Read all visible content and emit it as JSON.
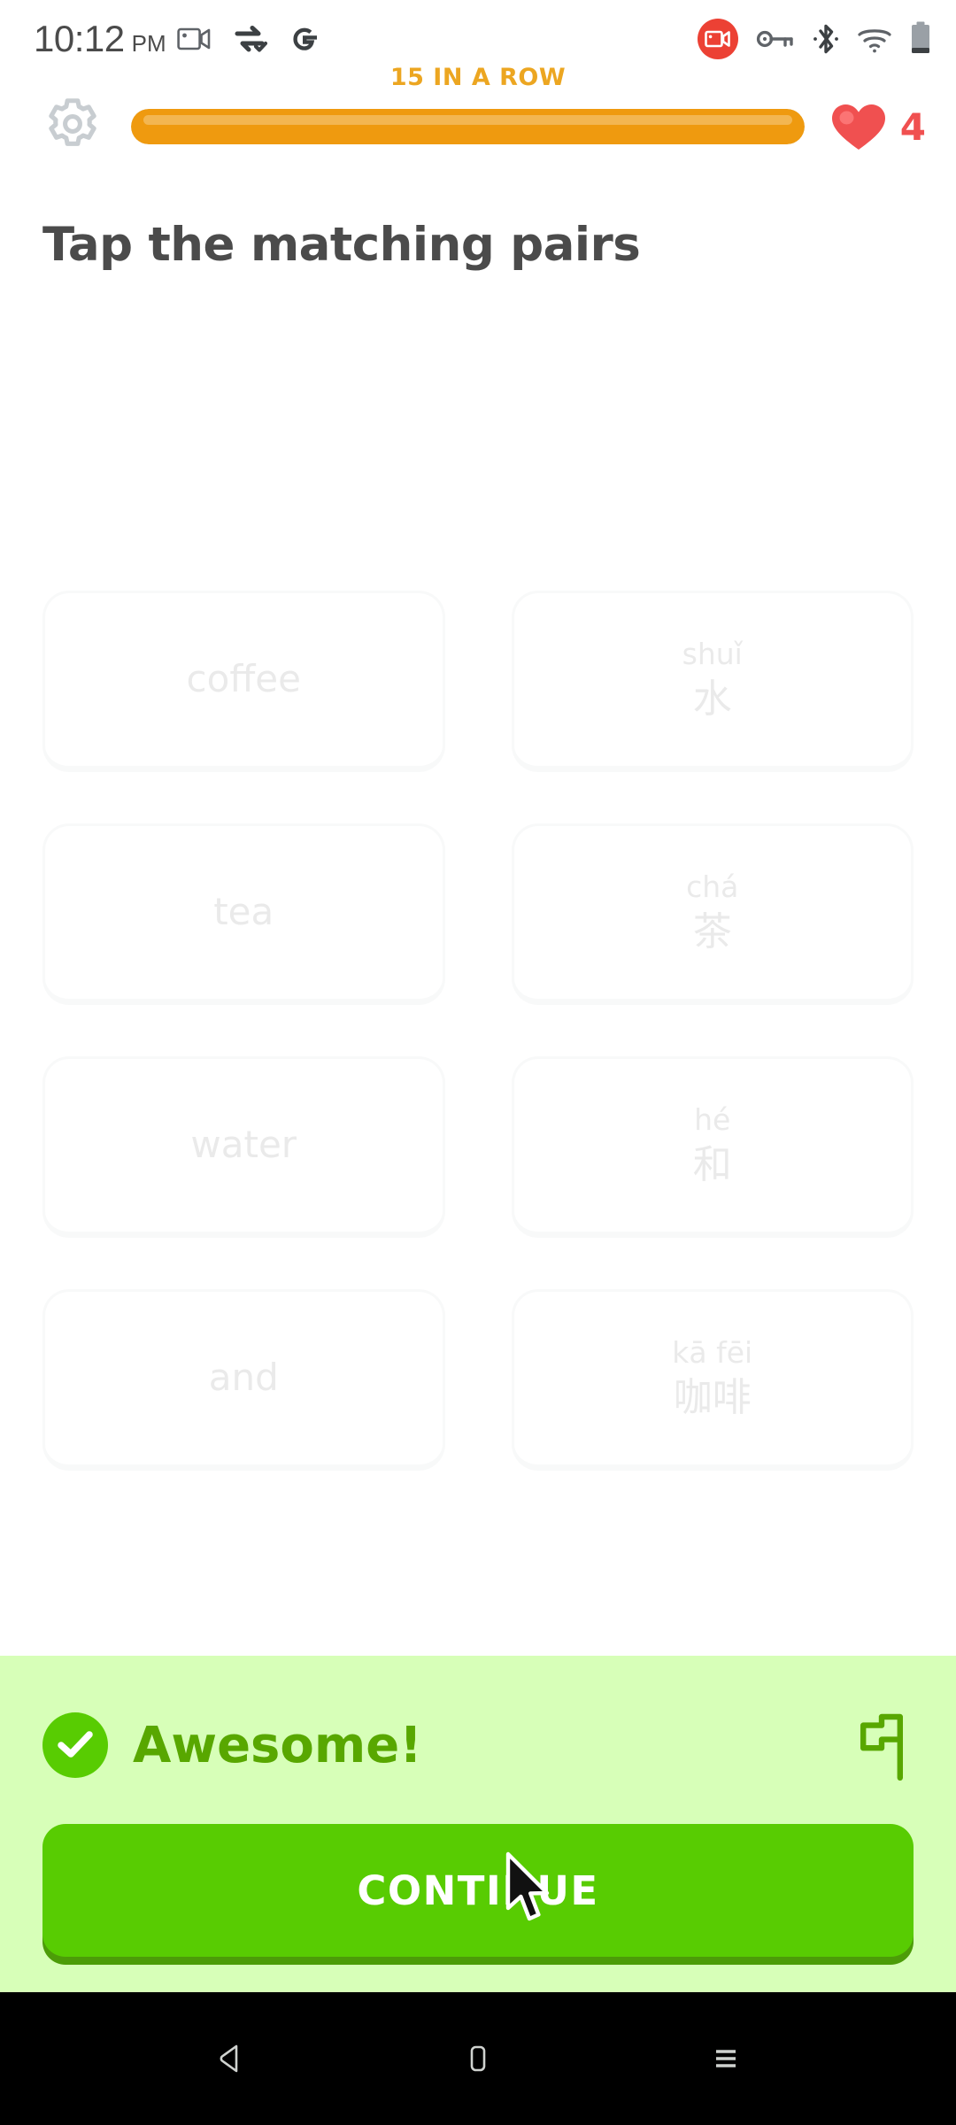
{
  "statusbar": {
    "time": "10:12",
    "ampm": "PM",
    "icons_left": [
      "screen-record-icon",
      "vpn-sync-icon",
      "google-icon"
    ],
    "icons_right": [
      "recording-badge-icon",
      "vpn-key-icon",
      "bluetooth-icon",
      "wifi-icon",
      "battery-icon"
    ]
  },
  "header": {
    "settings_icon": "gear-icon",
    "streak_label": "15 IN A ROW",
    "streak_color": "#eca621",
    "progress_percent": 100,
    "progress_color": "#ef9a0f",
    "heart_icon": "heart-icon",
    "heart_color": "#f05050",
    "hearts_count": "4"
  },
  "exercise": {
    "title": "Tap the matching pairs",
    "pairs": [
      {
        "english": "coffee",
        "pinyin": "shuǐ",
        "chinese": "水"
      },
      {
        "english": "tea",
        "pinyin": "chá",
        "chinese": "茶"
      },
      {
        "english": "water",
        "pinyin": "hé",
        "chinese": "和"
      },
      {
        "english": "and",
        "pinyin": "kā fēi",
        "chinese": "咖啡"
      }
    ]
  },
  "feedback": {
    "check_icon": "check-circle-icon",
    "message": "Awesome!",
    "message_color": "#58a700",
    "panel_color": "#d7ffb8",
    "report_icon": "flag-icon",
    "continue_label": "CONTINUE",
    "continue_color": "#58cc02",
    "cursor_icon": "mouse-pointer-icon"
  },
  "navbar": {
    "back_icon": "back-triangle-icon",
    "home_icon": "home-square-icon",
    "recents_icon": "recents-menu-icon"
  }
}
